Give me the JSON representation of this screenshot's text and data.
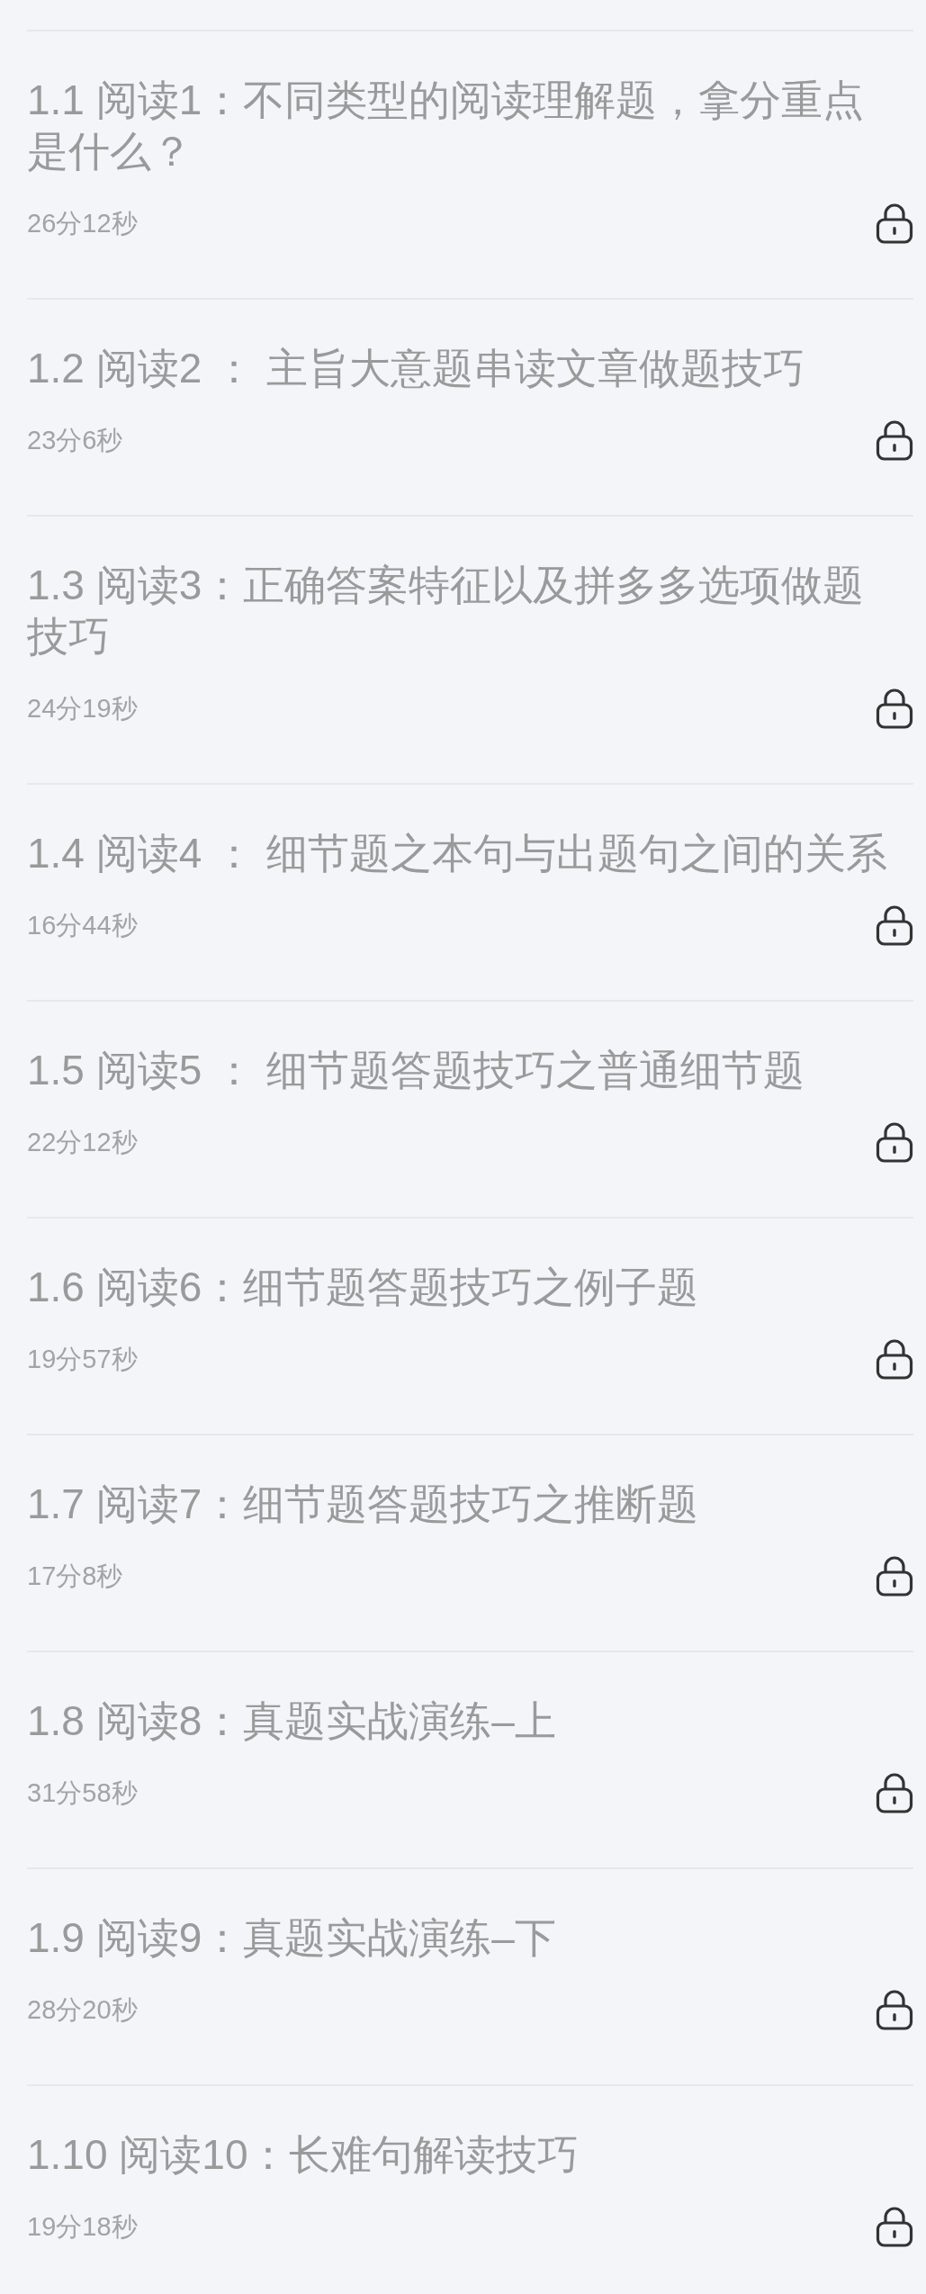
{
  "lessons": [
    {
      "title": "1.1 阅读1：不同类型的阅读理解题，拿分重点是什么？",
      "duration": "26分12秒",
      "locked": true
    },
    {
      "title": "1.2 阅读2 ： 主旨大意题串读文章做题技巧",
      "duration": "23分6秒",
      "locked": true
    },
    {
      "title": "1.3 阅读3：正确答案特征以及拼多多选项做题技巧",
      "duration": "24分19秒",
      "locked": true
    },
    {
      "title": "1.4 阅读4 ： 细节题之本句与出题句之间的关系",
      "duration": "16分44秒",
      "locked": true
    },
    {
      "title": "1.5 阅读5 ： 细节题答题技巧之普通细节题",
      "duration": "22分12秒",
      "locked": true
    },
    {
      "title": "1.6 阅读6：细节题答题技巧之例子题",
      "duration": "19分57秒",
      "locked": true
    },
    {
      "title": "1.7 阅读7：细节题答题技巧之推断题",
      "duration": "17分8秒",
      "locked": true
    },
    {
      "title": "1.8 阅读8：真题实战演练–上",
      "duration": "31分58秒",
      "locked": true
    },
    {
      "title": "1.9 阅读9：真题实战演练–下",
      "duration": "28分20秒",
      "locked": true
    },
    {
      "title": "1.10 阅读10：长难句解读技巧",
      "duration": "19分18秒",
      "locked": true
    }
  ]
}
